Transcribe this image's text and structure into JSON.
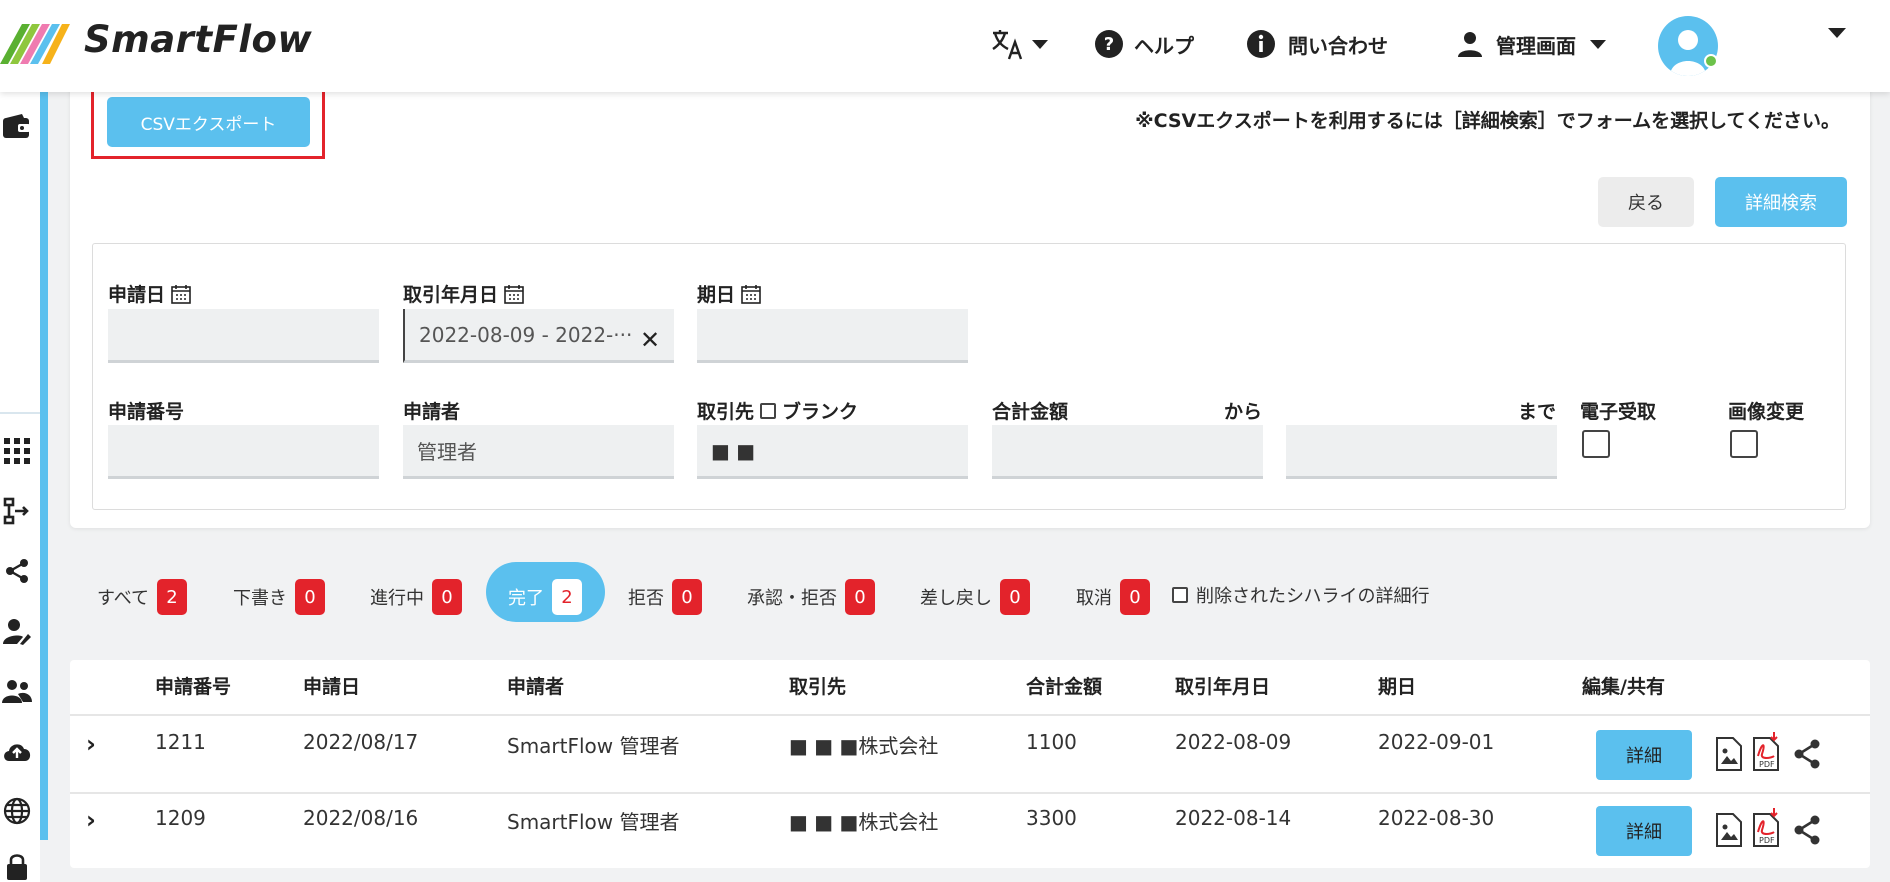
{
  "app": {
    "name": "SmartFlow"
  },
  "header": {
    "help": "ヘルプ",
    "contact": "問い合わせ",
    "admin": "管理画面"
  },
  "toolbar": {
    "csv_export": "CSVエクスポート",
    "csv_note": "※CSVエクスポートを利用するには［詳細検索］でフォームを選択してください。",
    "back": "戻る",
    "advanced_search": "詳細検索"
  },
  "filters": {
    "apply_date": {
      "label": "申請日",
      "value": ""
    },
    "trade_date": {
      "label": "取引年月日",
      "value": "2022-08-09 - 2022-···"
    },
    "due_date": {
      "label": "期日",
      "value": ""
    },
    "apply_no": {
      "label": "申請番号",
      "value": ""
    },
    "applicant": {
      "label": "申請者",
      "value": "管理者"
    },
    "partner": {
      "label": "取引先",
      "blank_label": "ブランク",
      "value": "■ ■"
    },
    "total": {
      "label": "合計金額",
      "from": "から",
      "to": "まで"
    },
    "e_receipt": {
      "label": "電子受取"
    },
    "image_change": {
      "label": "画像変更"
    }
  },
  "tabs": [
    {
      "label": "すべて",
      "count": "2"
    },
    {
      "label": "下書き",
      "count": "0"
    },
    {
      "label": "進行中",
      "count": "0"
    },
    {
      "label": "完了",
      "count": "2"
    },
    {
      "label": "拒否",
      "count": "0"
    },
    {
      "label": "承認・拒否",
      "count": "0"
    },
    {
      "label": "差し戻し",
      "count": "0"
    },
    {
      "label": "取消",
      "count": "0"
    }
  ],
  "deleted_rows_label": "削除されたシハライの詳細行",
  "table": {
    "headers": [
      "申請番号",
      "申請日",
      "申請者",
      "取引先",
      "合計金額",
      "取引年月日",
      "期日",
      "編集/共有"
    ],
    "rows": [
      {
        "no": "1211",
        "apply_date": "2022/08/17",
        "applicant": "SmartFlow 管理者",
        "partner": "■ ■ ■株式会社",
        "total": "1100",
        "trade_date": "2022-08-09",
        "due": "2022-09-01",
        "action": "詳細"
      },
      {
        "no": "1209",
        "apply_date": "2022/08/16",
        "applicant": "SmartFlow 管理者",
        "partner": "■ ■ ■株式会社",
        "total": "3300",
        "trade_date": "2022-08-14",
        "due": "2022-08-30",
        "action": "詳細"
      }
    ]
  },
  "colors": {
    "accent": "#5bc0ee",
    "badge": "#e3232b",
    "highlight": "#e3232b"
  }
}
